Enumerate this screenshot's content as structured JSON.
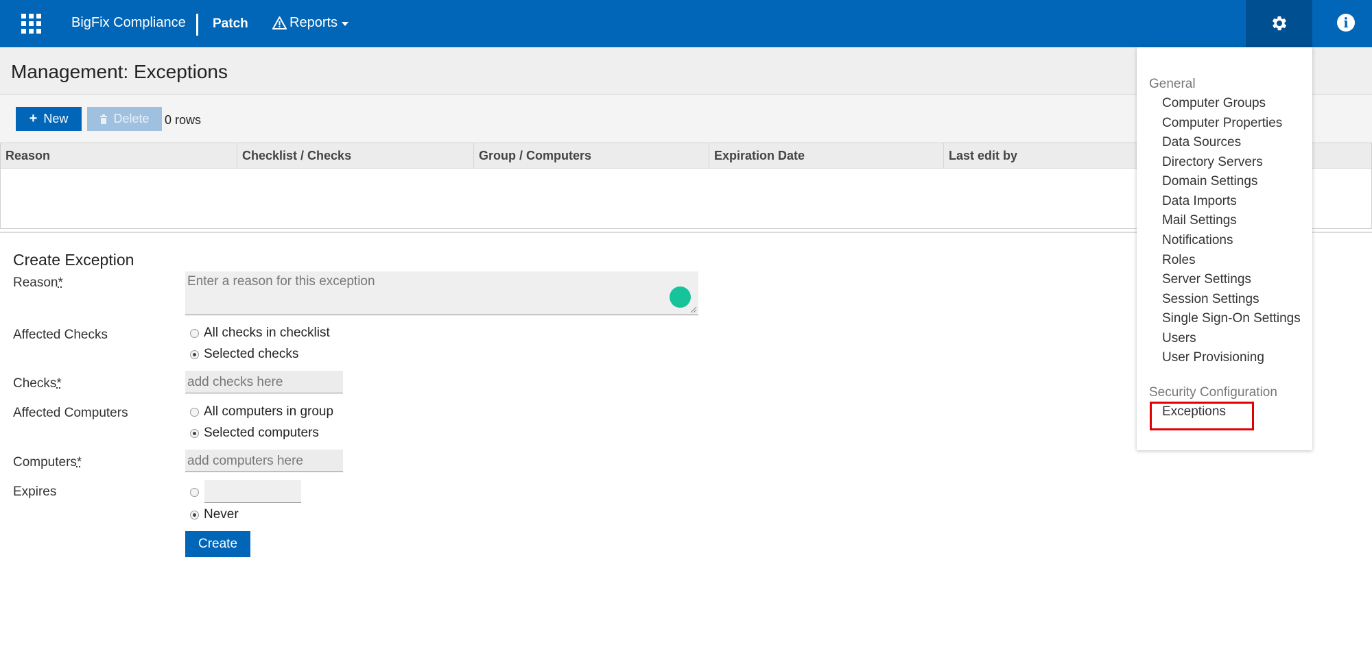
{
  "header": {
    "brand": "BigFix Compliance",
    "app_section": "Patch",
    "reports_label": "Reports",
    "colors": {
      "primary": "#0166b8",
      "active": "#004f90"
    }
  },
  "page": {
    "title": "Management: Exceptions"
  },
  "toolbar": {
    "new_label": "New",
    "delete_label": "Delete",
    "rows_count": "0 rows"
  },
  "table": {
    "columns": [
      "Reason",
      "Checklist / Checks",
      "Group / Computers",
      "Expiration Date",
      "Last edit by"
    ]
  },
  "form": {
    "title": "Create Exception",
    "reason_label": "Reason",
    "reason_placeholder": "Enter a reason for this exception",
    "affected_checks_label": "Affected Checks",
    "checks_options": [
      "All checks in checklist",
      "Selected checks"
    ],
    "checks_label": "Checks",
    "checks_placeholder": "add checks here",
    "affected_computers_label": "Affected Computers",
    "computers_options": [
      "All computers in group",
      "Selected computers"
    ],
    "computers_label": "Computers",
    "computers_placeholder": "add computers here",
    "expires_label": "Expires",
    "never_label": "Never",
    "create_label": "Create",
    "required_marker": "*"
  },
  "settings_menu": {
    "general_heading": "General",
    "general_items": [
      "Computer Groups",
      "Computer Properties",
      "Data Sources",
      "Directory Servers",
      "Domain Settings",
      "Data Imports",
      "Mail Settings",
      "Notifications",
      "Roles",
      "Server Settings",
      "Session Settings",
      "Single Sign-On Settings",
      "Users",
      "User Provisioning"
    ],
    "security_heading": "Security Configuration",
    "security_items": [
      "Exceptions"
    ]
  },
  "icons": [
    "apps-grid-icon",
    "warning-triangle-icon",
    "chevron-down-icon",
    "gear-icon",
    "info-icon",
    "plus-icon",
    "trash-icon"
  ]
}
